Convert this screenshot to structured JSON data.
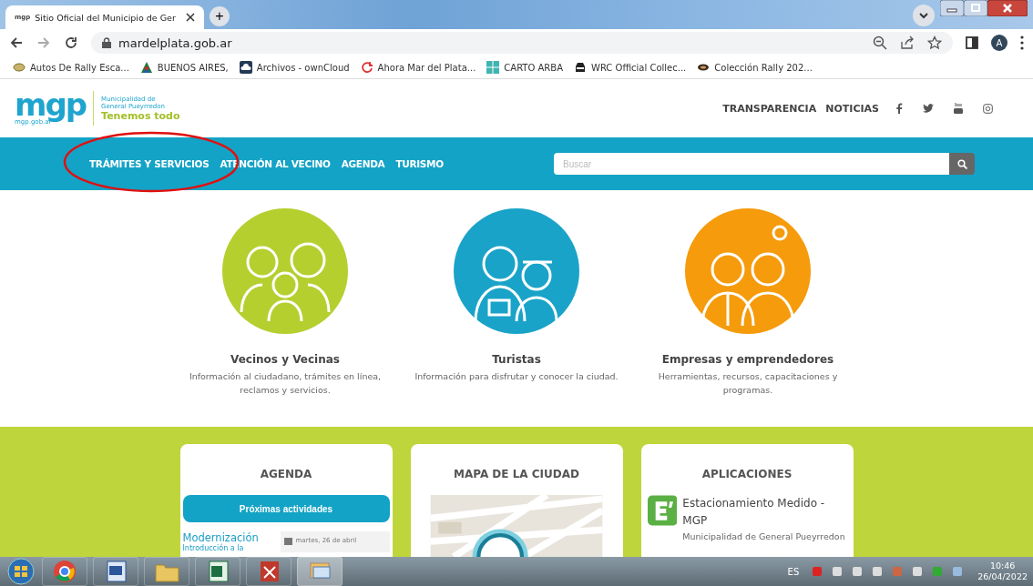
{
  "browser": {
    "tabs": [
      {
        "favicon": "mgp",
        "title": "Sitio Oficial del Municipio de Ger",
        "selected": true
      }
    ],
    "new_tab": "+",
    "url": "mardelplata.gob.ar",
    "profile": "A",
    "bookmarks": [
      "Autos De Rally Esca...",
      "BUENOS AIRES,",
      "Archivos - ownCloud",
      "Ahora Mar del Plata...",
      "CARTO ARBA",
      "WRC Official Collec...",
      "Colección Rally 202..."
    ]
  },
  "site": {
    "logo": {
      "mark": "mgp",
      "domain": "mgp.gob.ar",
      "line1": "Municipalidad de",
      "line2": "General Pueyrredon",
      "tagline": "Tenemos todo"
    },
    "top_links": [
      "TRANSPARENCIA",
      "NOTICIAS"
    ],
    "nav": [
      "TRÁMITES Y SERVICIOS",
      "ATENCIÓN AL VECINO",
      "AGENDA",
      "TURISMO"
    ],
    "search": {
      "placeholder": "Buscar"
    },
    "audiences": [
      {
        "title": "Vecinos y Vecinas",
        "description": "Información al ciudadano, trámites en línea, reclamos y servicios.",
        "color": "#b5cf2f"
      },
      {
        "title": "Turistas",
        "description": "Información para disfrutar y conocer la ciudad.",
        "color": "#1aa3c8"
      },
      {
        "title": "Empresas y emprendedores",
        "description": "Herramientas, recursos, capacitaciones y programas.",
        "color": "#f59b0c"
      }
    ],
    "cards": [
      {
        "kind": "agenda",
        "title": "AGENDA",
        "button": "Próximas actividades",
        "event_title": "Modernización",
        "event_text": "Introducción a la",
        "event_date": "martes, 26 de abril"
      },
      {
        "kind": "map",
        "title": "MAPA DE LA CIUDAD"
      },
      {
        "kind": "apps",
        "title": "APLICACIONES",
        "app_name": "Estacionamiento Medido - MGP",
        "app_publisher": "Municipalidad de General Pueyrredon"
      }
    ]
  },
  "taskbar": {
    "language": "ES",
    "time": "10:46",
    "date": "26/04/2022"
  }
}
